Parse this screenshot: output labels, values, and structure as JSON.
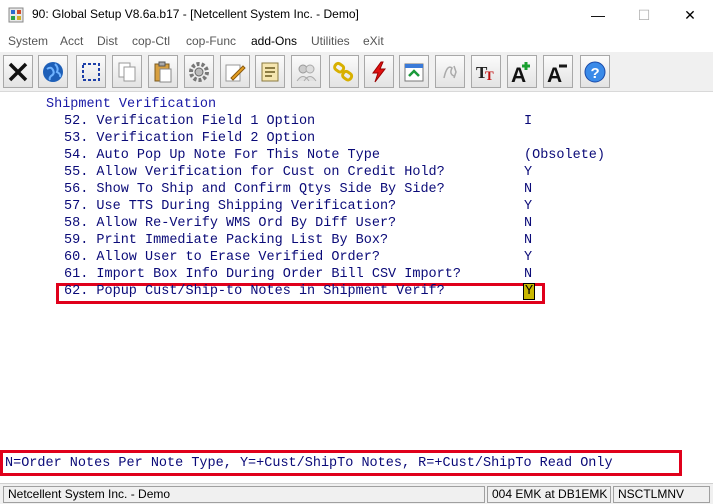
{
  "window": {
    "title": "90: Global Setup V8.6a.b17 - [Netcellent System Inc. - Demo]",
    "min_glyph": "—",
    "max_glyph": "☐",
    "close_glyph": "✕"
  },
  "menu": [
    {
      "label": "System"
    },
    {
      "label": "Acct"
    },
    {
      "label": "Dist"
    },
    {
      "label": "cop-Ctl"
    },
    {
      "label": "cop-Func"
    },
    {
      "label": "add-Ons"
    },
    {
      "label": "Utilities"
    },
    {
      "label": "eXit"
    }
  ],
  "toolbar_icons": [
    "close-icon",
    "globe-icon",
    "select-icon",
    "copy-icon",
    "paste-icon",
    "settings-icon",
    "edit-icon",
    "notes-icon",
    "users-icon",
    "link-icon",
    "power-icon",
    "export-icon",
    "script-icon",
    "font-size-icon",
    "increase-font-icon",
    "decrease-font-icon",
    "help-icon"
  ],
  "screen": {
    "section_title": "Shipment Verification",
    "rows": [
      {
        "label": "52. Verification Field 1 Option",
        "value": "I"
      },
      {
        "label": "53. Verification Field 2 Option",
        "value": ""
      },
      {
        "label": "54. Auto Pop Up Note For This Note Type",
        "value": "(Obsolete)"
      },
      {
        "label": "55. Allow Verification for Cust on Credit Hold?",
        "value": "Y"
      },
      {
        "label": "56. Show To Ship and Confirm Qtys Side By Side?",
        "value": "N"
      },
      {
        "label": "57. Use TTS During Shipping Verification?",
        "value": "Y"
      },
      {
        "label": "58. Allow Re-Verify WMS Ord By Diff User?",
        "value": "N"
      },
      {
        "label": "59. Print Immediate Packing List By Box?",
        "value": "N"
      },
      {
        "label": "60. Allow User to Erase Verified Order?",
        "value": "Y"
      },
      {
        "label": "61. Import Box Info During Order Bill CSV Import?",
        "value": "N"
      },
      {
        "label": "62. Popup Cust/Ship-to Notes in Shipment Verif?",
        "value": "Y"
      }
    ]
  },
  "help_line": "N=Order Notes Per Note Type, Y=+Cust/ShipTo Notes, R=+Cust/ShipTo Read Only",
  "status": {
    "company": "Netcellent System Inc. - Demo",
    "session": "004 EMK at DB1EMK",
    "node": "NSCTLMNV"
  },
  "colors": {
    "accent_red": "#e0001b",
    "text_blue": "#0a0a78",
    "cursor_yellow": "#c9b800"
  }
}
